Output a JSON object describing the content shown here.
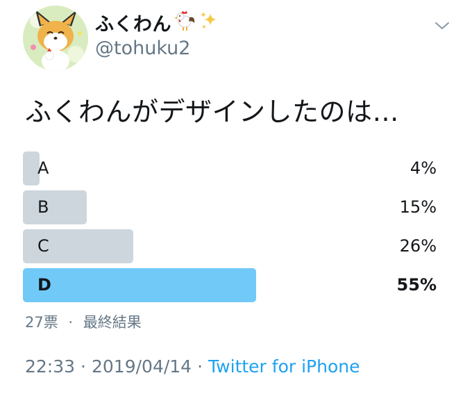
{
  "user": {
    "display_name": "ふくわん",
    "name_icons": [
      "rooster-icon",
      "sparkles-icon"
    ],
    "handle": "@tohuku2"
  },
  "question": "ふくわんがデザインしたのは…",
  "poll": {
    "options": [
      {
        "label": "A",
        "percent": 4,
        "percent_text": "4%",
        "winner": false
      },
      {
        "label": "B",
        "percent": 15,
        "percent_text": "15%",
        "winner": false
      },
      {
        "label": "C",
        "percent": 26,
        "percent_text": "26%",
        "winner": false
      },
      {
        "label": "D",
        "percent": 55,
        "percent_text": "55%",
        "winner": true
      }
    ],
    "votes_text": "27票",
    "separator": "·",
    "status_text": "最終結果"
  },
  "footer": {
    "time": "22:33",
    "separator": "·",
    "date": "2019/04/14",
    "source": "Twitter for iPhone"
  },
  "colors": {
    "bar_default": "#cdd6dd",
    "bar_winner": "#71c9f8",
    "secondary_text": "#657786",
    "link": "#1da1f2"
  }
}
